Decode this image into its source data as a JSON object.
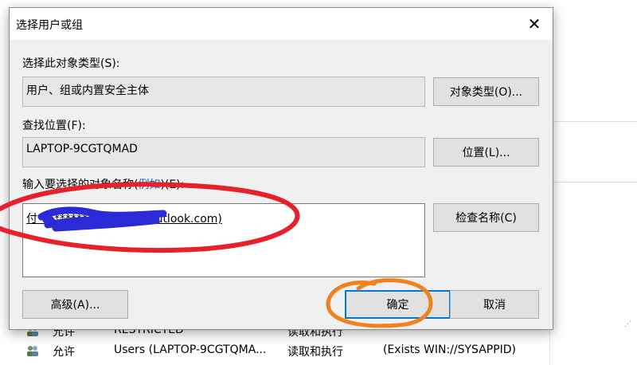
{
  "background": {
    "rows": [
      {
        "type": "允许",
        "principal": "RESTRICTED",
        "access": "读取和执行",
        "applies": ""
      },
      {
        "type": "允许",
        "principal": "Users (LAPTOP-9CGTQMA...",
        "access": "读取和执行",
        "applies": "(Exists WIN://SYSAPPID)"
      }
    ]
  },
  "dialog": {
    "title": "选择用户或组",
    "close_glyph": "✕",
    "object_type_label": "选择此对象类型(S):",
    "object_type_value": "用户、组或内置安全主体",
    "object_types_button": "对象类型(O)...",
    "location_label": "查找位置(F):",
    "location_value": "LAPTOP-9CGTQMAD",
    "locations_button": "位置(L)...",
    "names_label_prefix": "输入要选择的对象名称(",
    "names_label_link": "例如",
    "names_label_suffix": ")(E):",
    "names_value": "付******************@outlook.com)",
    "check_names_button": "检查名称(C)",
    "advanced_button": "高级(A)...",
    "ok_button": "确定",
    "cancel_button": "取消"
  },
  "colors": {
    "red_annotation": "#e8202a",
    "blue_redaction": "#2a2ad6",
    "orange_annotation": "#f0821e",
    "accent_border": "#0078d7"
  }
}
